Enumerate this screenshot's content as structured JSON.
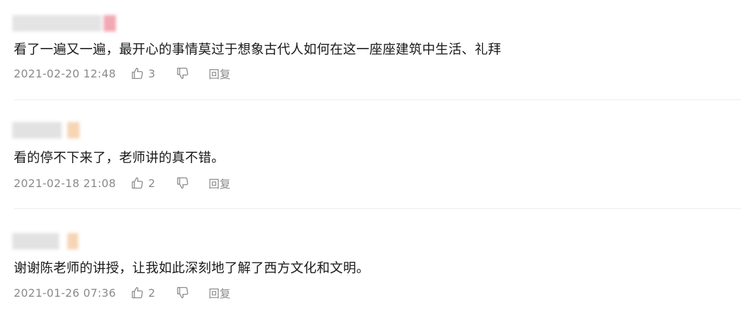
{
  "comments": [
    {
      "text": "看了一遍又一遍，最开心的事情莫过于想象古代人如何在这一座座建筑中生活、礼拜",
      "time": "2021-02-20 12:48",
      "likes": "3",
      "reply_label": "回复"
    },
    {
      "text": "看的停不下来了，老师讲的真不错。",
      "time": "2021-02-18 21:08",
      "likes": "2",
      "reply_label": "回复"
    },
    {
      "text": "谢谢陈老师的讲授，让我如此深刻地了解了西方文化和文明。",
      "time": "2021-01-26 07:36",
      "likes": "2",
      "reply_label": "回复"
    }
  ],
  "icons": {
    "like": "thumbs-up-icon",
    "dislike": "thumbs-down-icon"
  },
  "colors": {
    "text": "#1a1a1a",
    "meta": "#8a8a8a",
    "divider": "#ececec"
  }
}
